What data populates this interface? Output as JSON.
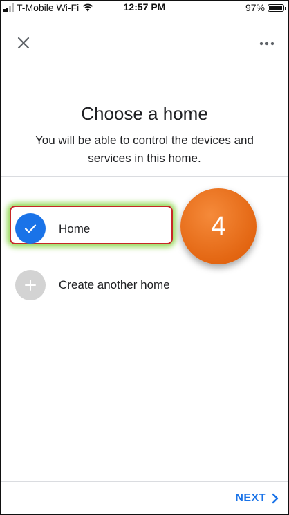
{
  "status_bar": {
    "carrier": "T-Mobile Wi-Fi",
    "time": "12:57 PM",
    "battery": "97%",
    "battery_level": 0.97,
    "wifi_icon": "wifi-icon",
    "signal_icon": "signal-bars-icon"
  },
  "header": {
    "close_icon": "close-icon",
    "more_icon": "more-horizontal-icon"
  },
  "main": {
    "title": "Choose a home",
    "subtitle": "You will be able to control the devices and services in this home.",
    "options": [
      {
        "label": "Home",
        "selected": true,
        "icon": "check-icon"
      },
      {
        "label": "Create another home",
        "selected": false,
        "icon": "plus-icon"
      }
    ]
  },
  "annotation": {
    "step_number": "4",
    "badge_color": "#e8711a",
    "highlight_color": "#c62828",
    "glow_color": "#82d23c"
  },
  "footer": {
    "next_label": "NEXT",
    "next_icon": "chevron-right-icon"
  },
  "colors": {
    "accent": "#1a73e8",
    "inactive": "#d3d3d3",
    "text": "#202124"
  }
}
